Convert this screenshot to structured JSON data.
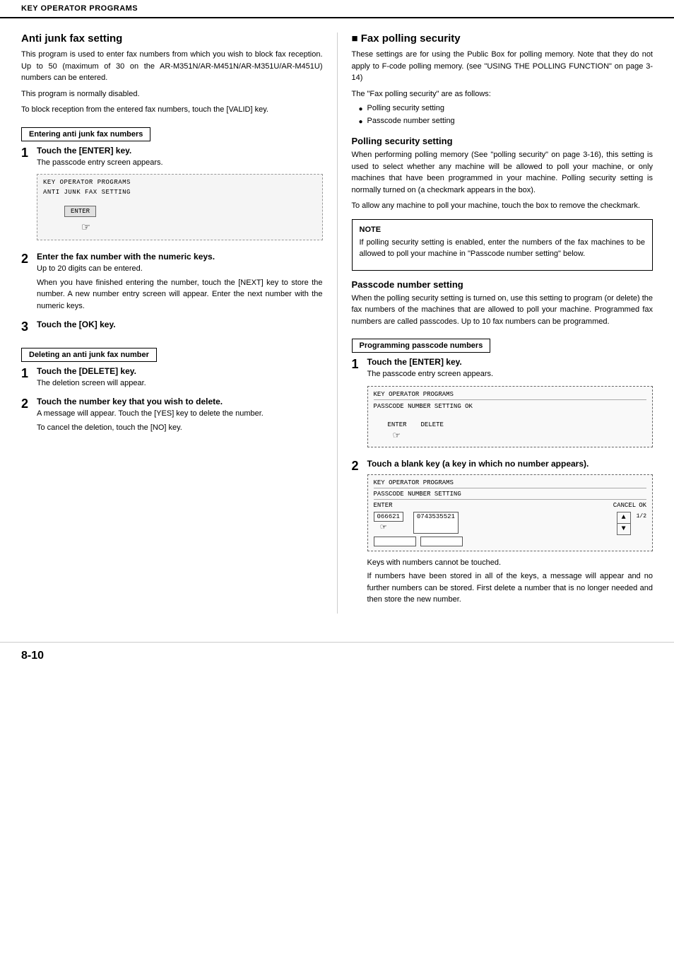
{
  "header": {
    "title": "KEY OPERATOR PROGRAMS"
  },
  "footer": {
    "page": "8-10"
  },
  "left": {
    "section_title": "Anti junk fax setting",
    "intro": [
      "This program is used to enter fax numbers from which you wish to block fax reception. Up to 50 (maximum of 30 on the AR-M351N/AR-M451N/AR-M351U/AR-M451U) numbers can be entered.",
      "This program is normally disabled.",
      "To block reception from the entered fax numbers, touch the [VALID] key."
    ],
    "box1_label": "Entering anti junk fax numbers",
    "step1_title": "Touch the [ENTER] key.",
    "step1_desc": "The passcode entry screen appears.",
    "screen1": {
      "line1": "KEY OPERATOR PROGRAMS",
      "line2": "ANTI JUNK FAX SETTING",
      "btn": "ENTER"
    },
    "step2_title": "Enter the fax number with the numeric keys.",
    "step2_desc": [
      "Up to 20 digits can be entered.",
      "When you have finished entering the number, touch the [NEXT] key to store the number. A new number entry screen will appear. Enter the next number with the numeric keys."
    ],
    "step3_title": "Touch the [OK] key.",
    "box2_label": "Deleting an anti junk fax number",
    "del_step1_title": "Touch the [DELETE] key.",
    "del_step1_desc": "The deletion screen will appear.",
    "del_step2_title": "Touch the number key that you wish to delete.",
    "del_step2_desc": [
      "A message will appear. Touch the [YES] key to delete the number.",
      "To cancel the deletion, touch the [NO] key."
    ]
  },
  "right": {
    "section_title": "Fax polling security",
    "intro": [
      "These settings are for using the Public Box for polling memory. Note that they do not apply to F-code polling memory. (see \"USING THE POLLING FUNCTION\" on page 3-14)",
      "The \"Fax polling security\" are as follows:"
    ],
    "bullet_items": [
      "Polling security setting",
      "Passcode number setting"
    ],
    "polling_title": "Polling security setting",
    "polling_desc": "When performing polling memory (See \"polling security\" on page 3-16), this setting is used to select whether any machine will be allowed to poll your machine, or only machines that have been programmed in your machine. Polling security setting is normally turned on (a checkmark appears in the box).",
    "polling_desc2": "To allow any machine to poll your machine, touch the box to remove the checkmark.",
    "note_title": "NOTE",
    "note_text": "If polling security setting is enabled, enter the numbers of the fax machines to be allowed to poll your machine in \"Passcode number setting\" below.",
    "passcode_title": "Passcode number setting",
    "passcode_desc": "When the polling security setting is turned on, use this setting to program (or delete) the fax numbers of the machines that are allowed to poll your machine. Programmed fax numbers are called passcodes. Up to 10 fax numbers can be programmed.",
    "box_prog_label": "Programming passcode numbers",
    "prog_step1_title": "Touch the [ENTER] key.",
    "prog_step1_desc": "The passcode entry screen appears.",
    "screen_prog": {
      "line1": "KEY OPERATOR PROGRAMS",
      "line2": "PASSCODE NUMBER SETTING",
      "ok_btn": "OK",
      "enter_btn": "ENTER",
      "delete_btn": "DELETE"
    },
    "prog_step2_title": "Touch a blank key (a key in which no number appears).",
    "screen_prog2": {
      "line1": "KEY OPERATOR PROGRAMS",
      "line2": "PASSCODE NUMBER SETTING",
      "enter_label": "ENTER",
      "cancel_btn": "CANCEL",
      "ok_btn": "OK",
      "number1": "0743535521",
      "number2": "066621",
      "page": "1/2"
    },
    "prog_step2_note1": "Keys with numbers cannot be touched.",
    "prog_step2_note2": "If numbers have been stored in all of the keys, a message will appear and no further numbers can be stored. First delete a number that is no longer needed and then store the new number."
  }
}
